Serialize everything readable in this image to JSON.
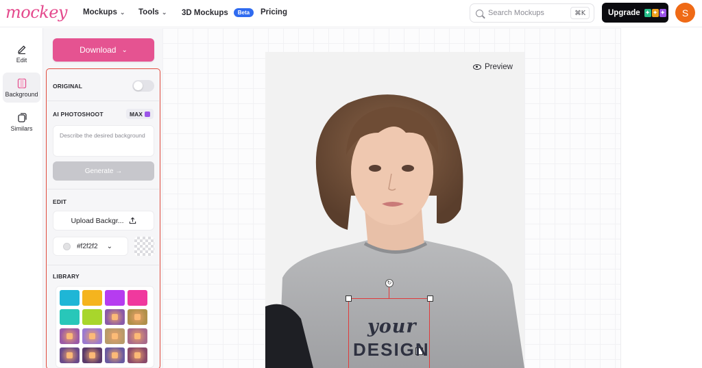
{
  "brand": {
    "logo_text": "mockey",
    "accent": "#e55391"
  },
  "nav": {
    "items": [
      {
        "label": "Mockups",
        "has_dropdown": true
      },
      {
        "label": "Tools",
        "has_dropdown": true
      },
      {
        "label": "3D Mockups",
        "badge": "Beta"
      },
      {
        "label": "Pricing"
      }
    ]
  },
  "search": {
    "placeholder": "Search Mockups",
    "shortcut": "⌘K"
  },
  "upgrade": {
    "label": "Upgrade"
  },
  "user": {
    "avatar_initial": "S",
    "avatar_color": "#ef6a16"
  },
  "rail": {
    "items": [
      {
        "label": "Edit",
        "icon": "pencil-icon",
        "active": false
      },
      {
        "label": "Background",
        "icon": "background-icon",
        "active": true
      },
      {
        "label": "Similars",
        "icon": "similars-icon",
        "active": false
      }
    ]
  },
  "panel": {
    "download_label": "Download",
    "original": {
      "label": "ORIGINAL",
      "enabled": false
    },
    "ai_photoshoot": {
      "label": "AI PHOTOSHOOT",
      "badge": "MAX",
      "prompt_placeholder": "Describe the desired background",
      "generate_label": "Generate →"
    },
    "edit": {
      "label": "EDIT",
      "upload_label": "Upload Backgr...",
      "color_value": "#f2f2f2"
    },
    "library": {
      "label": "LIBRARY",
      "swatches": [
        "#1fb6d6",
        "#f5b41e",
        "#b63cf0",
        "#f0399e",
        "#28c7b9",
        "#a8d62c",
        "#8a5aa8",
        "#b0904a",
        "#9a5aa6",
        "#9a7ad0",
        "#b89a6a",
        "#a86a8a",
        "#6a4a8a",
        "#5a3a6a",
        "#6a5aa0",
        "#8a4a6a"
      ]
    }
  },
  "canvas": {
    "preview_label": "Preview",
    "mockup_bg": "#f2f2f2",
    "design_text_line1": "your",
    "design_text_line2": "DESIGN"
  }
}
